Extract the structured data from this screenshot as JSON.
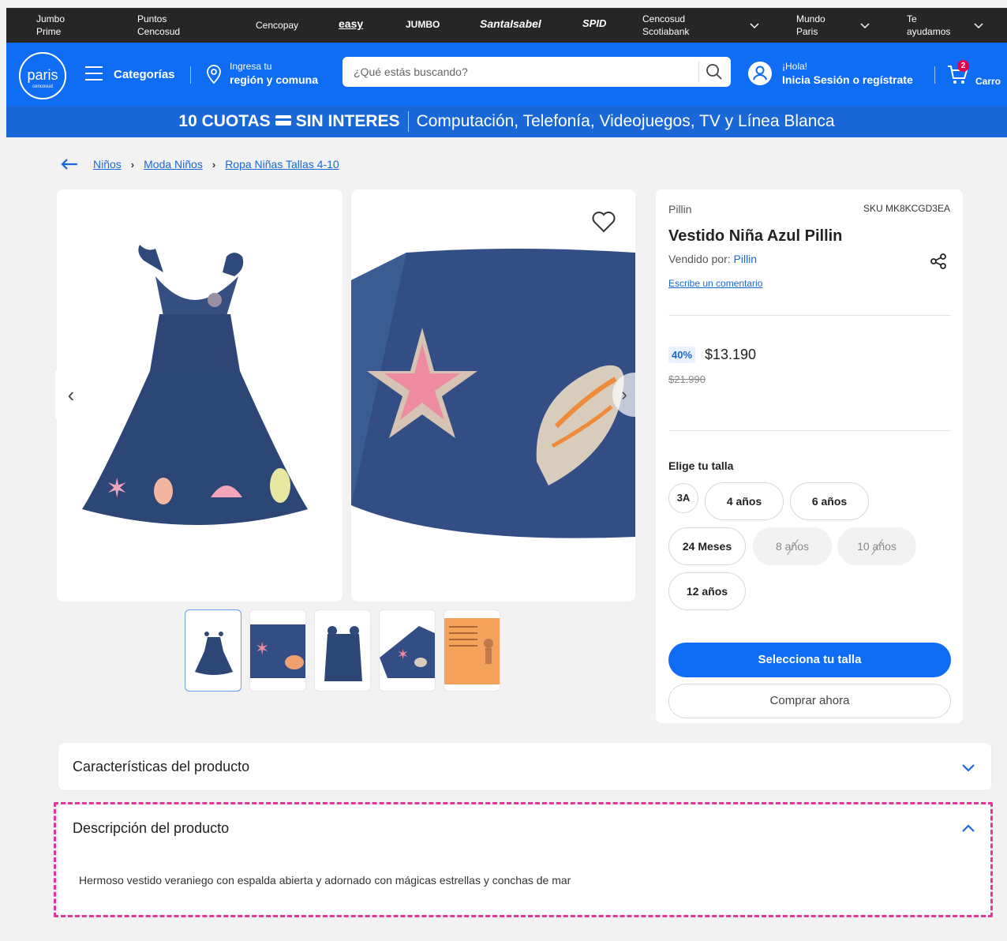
{
  "topbar": {
    "items": [
      {
        "line1": "Jumbo",
        "line2": "Prime"
      },
      {
        "line1": "Puntos",
        "line2": "Cencosud"
      },
      {
        "label": "Cencopay"
      },
      {
        "logo": "easy"
      },
      {
        "logo": "JUMBO"
      },
      {
        "logo": "SantaIsabel"
      },
      {
        "logo": "SPID"
      },
      {
        "line1": "Cencosud",
        "line2": "Scotiabank"
      },
      {
        "line1": "Mundo",
        "line2": "Paris"
      },
      {
        "line1": "Te",
        "line2": "ayudamos"
      }
    ]
  },
  "header": {
    "logo_word": "paris",
    "logo_sub": "cencosud",
    "categories_label": "Categorías",
    "region_line1": "Ingresa tu",
    "region_line2": "región y comuna",
    "search_placeholder": "¿Qué estás buscando?",
    "hello_line1": "¡Hola!",
    "hello_line2": "Inicia Sesión o regístrate",
    "cart_count": "2",
    "cart_label": "Carro",
    "brand_color": "#0f6df4"
  },
  "banner": {
    "bold_part1": "10 CUOTAS",
    "bold_part2": "SIN INTERES",
    "rest": "Computación, Telefonía, Videojuegos, TV y Línea Blanca"
  },
  "breadcrumb": [
    "Niños",
    "Moda Niños",
    "Ropa Niñas Tallas 4-10"
  ],
  "product": {
    "brand": "Pillin",
    "sku": "SKU MK8KCGD3EA",
    "title": "Vestido Niña Azul Pillin",
    "sold_by_label": "Vendido por:",
    "seller": "Pillin",
    "review_link": "Escribe un comentario",
    "discount": "40%",
    "price": "$13.190",
    "old_price": "$21.990",
    "size_label": "Elige tu talla",
    "sizes": [
      {
        "label": "3A",
        "available": true
      },
      {
        "label": "4 años",
        "available": true
      },
      {
        "label": "6 años",
        "available": true
      },
      {
        "label": "24 Meses",
        "available": true
      },
      {
        "label": "8 años",
        "available": false
      },
      {
        "label": "10 años",
        "available": false
      },
      {
        "label": "12 años",
        "available": true
      }
    ],
    "select_size_button": "Selecciona tu talla",
    "buy_now_button": "Comprar ahora"
  },
  "accordions": {
    "features_title": "Características del producto",
    "description_title": "Descripción del producto",
    "description_text": "Hermoso vestido veraniego con espalda abierta y adornado con mágicas estrellas y conchas de mar"
  },
  "icons": [
    "chevron-down-icon",
    "menu-icon",
    "location-pin-icon",
    "search-icon",
    "user-icon",
    "cart-icon",
    "back-arrow-icon",
    "heart-icon",
    "share-icon",
    "chevron-left-icon",
    "chevron-right-icon",
    "chevron-up-icon"
  ]
}
